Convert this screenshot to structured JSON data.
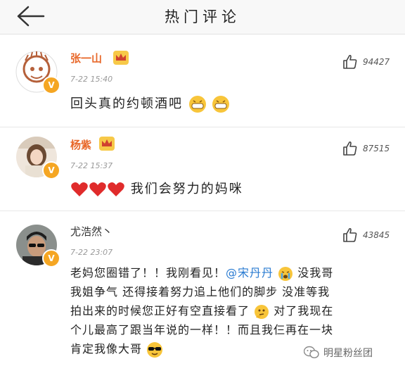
{
  "header": {
    "title": "热门评论"
  },
  "comments": [
    {
      "username": "张一山",
      "time": "7-22 15:40",
      "likes": "94427",
      "text": "回头真的约顿酒吧"
    },
    {
      "username": "杨紫",
      "time": "7-22 15:37",
      "likes": "87515",
      "text": "我们会努力的妈咪"
    },
    {
      "username": "尤浩然丶",
      "time": "7-22 23:07",
      "likes": "43845",
      "text_part1": "老妈您圈错了！！我刚看见！",
      "mention": "@宋丹丹",
      "text_part2": "没我哥",
      "line2": "我姐争气 还得接着努力追上他们的脚步 没准等我",
      "line3a": "拍出来的时候您正好有空直接看了",
      "line3b": "对了我现在",
      "line4": "个儿最高了跟当年说的一样！！而且我仨再在一块",
      "line5": "肯定我像大哥"
    }
  ],
  "watermark": {
    "text": "明星粉丝团"
  },
  "icons": {
    "back": "back-arrow-icon",
    "like": "thumbs-up-icon",
    "crown": "crown-icon",
    "verified": "verified-badge-icon"
  },
  "colors": {
    "username": "#e8682a",
    "mention": "#2a7bd1",
    "badge": "#f5a623"
  }
}
